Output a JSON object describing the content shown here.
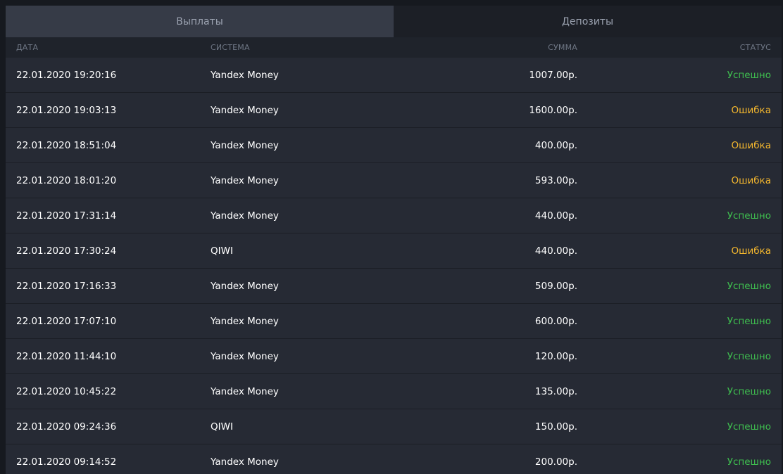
{
  "tabs": [
    {
      "label": "Выплаты",
      "active": true
    },
    {
      "label": "Депозиты",
      "active": false
    }
  ],
  "table": {
    "headers": {
      "date": "ДАТА",
      "system": "СИСТЕМА",
      "sum": "СУММА",
      "status": "СТАТУС"
    },
    "status_colors": {
      "Успешно": "#3fbf4f",
      "Ошибка": "#f5b82e"
    },
    "rows": [
      {
        "date": "22.01.2020 19:20:16",
        "system": "Yandex Money",
        "sum": "1007.00р.",
        "status": "Успешно"
      },
      {
        "date": "22.01.2020 19:03:13",
        "system": "Yandex Money",
        "sum": "1600.00р.",
        "status": "Ошибка"
      },
      {
        "date": "22.01.2020 18:51:04",
        "system": "Yandex Money",
        "sum": "400.00р.",
        "status": "Ошибка"
      },
      {
        "date": "22.01.2020 18:01:20",
        "system": "Yandex Money",
        "sum": "593.00р.",
        "status": "Ошибка"
      },
      {
        "date": "22.01.2020 17:31:14",
        "system": "Yandex Money",
        "sum": "440.00р.",
        "status": "Успешно"
      },
      {
        "date": "22.01.2020 17:30:24",
        "system": "QIWI",
        "sum": "440.00р.",
        "status": "Ошибка"
      },
      {
        "date": "22.01.2020 17:16:33",
        "system": "Yandex Money",
        "sum": "509.00р.",
        "status": "Успешно"
      },
      {
        "date": "22.01.2020 17:07:10",
        "system": "Yandex Money",
        "sum": "600.00р.",
        "status": "Успешно"
      },
      {
        "date": "22.01.2020 11:44:10",
        "system": "Yandex Money",
        "sum": "120.00р.",
        "status": "Успешно"
      },
      {
        "date": "22.01.2020 10:45:22",
        "system": "Yandex Money",
        "sum": "135.00р.",
        "status": "Успешно"
      },
      {
        "date": "22.01.2020 09:24:36",
        "system": "QIWI",
        "sum": "150.00р.",
        "status": "Успешно"
      },
      {
        "date": "22.01.2020 09:14:52",
        "system": "Yandex Money",
        "sum": "200.00р.",
        "status": "Успешно"
      }
    ]
  }
}
